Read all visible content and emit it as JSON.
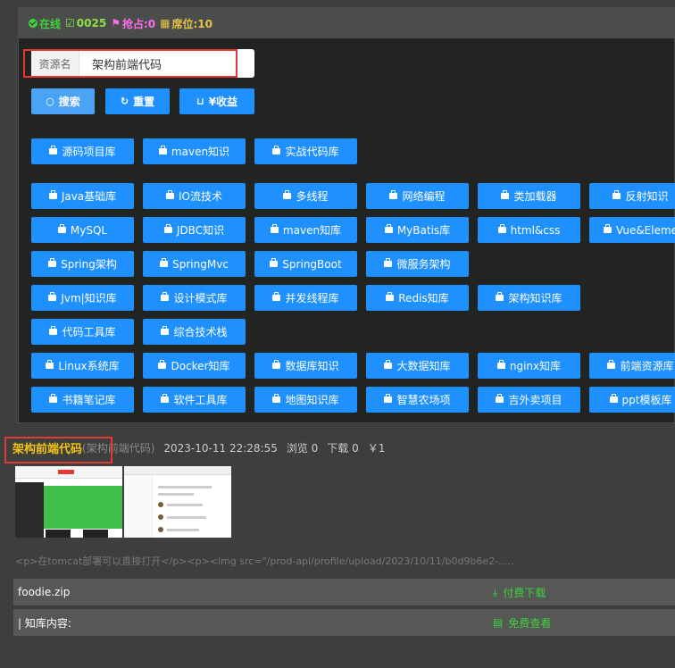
{
  "status": {
    "online": "在线",
    "code": "0025",
    "grab": "抢占:0",
    "seat": "席位:10"
  },
  "search": {
    "label": "资源名",
    "value": "架构前端代码"
  },
  "actions": {
    "search": "搜索",
    "reset": "重置",
    "income": "¥收益"
  },
  "categories": [
    "源码项目库",
    "maven知识",
    "实战代码库",
    "Java基础库",
    "IO流技术",
    "多线程",
    "网络编程",
    "类加载器",
    "反射知识",
    "MySQL",
    "JDBC知识",
    "maven知库",
    "MyBatis库",
    "html&css",
    "Vue&Eleme",
    "Spring架构",
    "SpringMvc",
    "SpringBoot",
    "微服务架构",
    "Jvm|知识库",
    "设计模式库",
    "并发线程库",
    "Redis知库",
    "架构知识库",
    "代码工具库",
    "综合技术栈",
    "Linux系统库",
    "Docker知库",
    "数据库知识",
    "大数据知库",
    "nginx知库",
    "前端资源库",
    "书籍笔记库",
    "软件工具库",
    "地图知识库",
    "智慧农场项",
    "吉外卖项目",
    "ppt模板库"
  ],
  "resource": {
    "title": "架构前端代码",
    "subtitle": "(架构前端代码)",
    "datetime": "2023-10-11 22:28:55",
    "views": "浏览 0",
    "downloads": "下载 0",
    "price": "￥1",
    "description": "<p>在tomcat部署可以直接打开</p><p><img src=\"/prod-api/profile/upload/2023/10/11/b0d9b6e2-.....",
    "file_name": "foodie.zip",
    "paid_download": "付费下载",
    "content_label": "| 知库内容:",
    "free_view": "免费查看"
  },
  "colors": {
    "button": "#1e90ff",
    "online": "#3fd13f",
    "title": "#f3c316",
    "highlight": "#e53935"
  }
}
